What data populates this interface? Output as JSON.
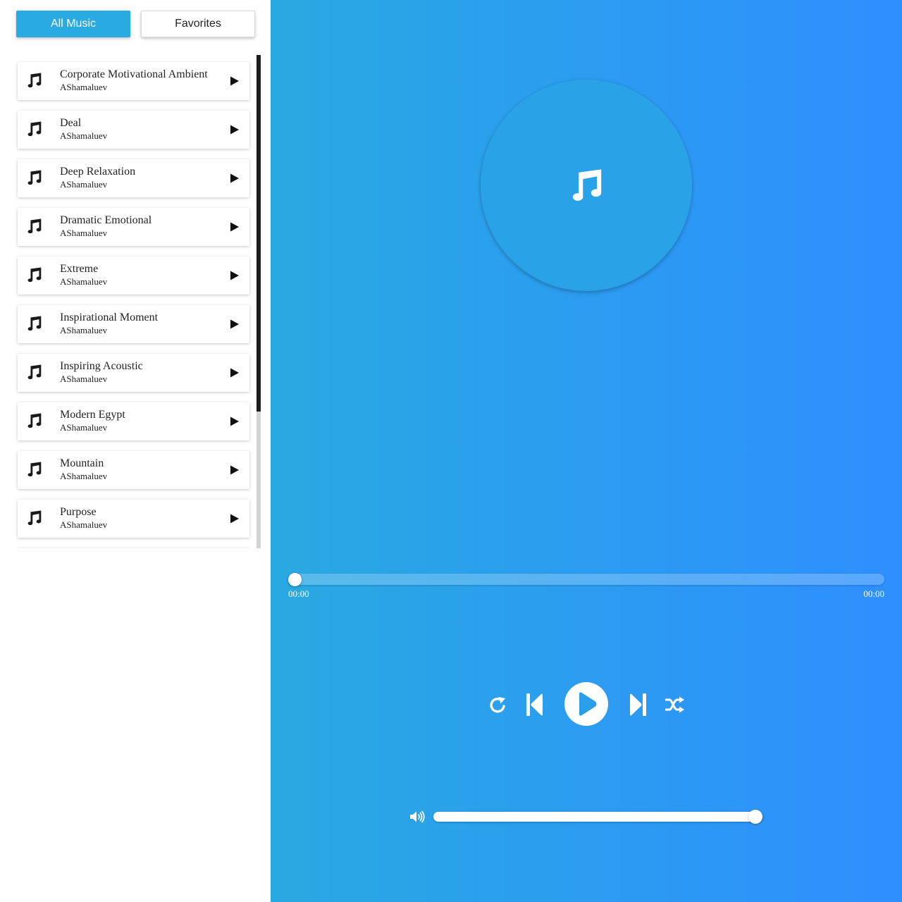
{
  "tabs": {
    "all_music": "All Music",
    "favorites": "Favorites"
  },
  "playlist": [
    {
      "title": "Corporate Motivational Ambient",
      "artist": "AShamaluev"
    },
    {
      "title": "Deal",
      "artist": "AShamaluev"
    },
    {
      "title": "Deep Relaxation",
      "artist": "AShamaluev"
    },
    {
      "title": "Dramatic Emotional",
      "artist": "AShamaluev"
    },
    {
      "title": "Extreme",
      "artist": "AShamaluev"
    },
    {
      "title": "Inspirational Moment",
      "artist": "AShamaluev"
    },
    {
      "title": "Inspiring Acoustic",
      "artist": "AShamaluev"
    },
    {
      "title": "Modern Egypt",
      "artist": "AShamaluev"
    },
    {
      "title": "Mountain",
      "artist": "AShamaluev"
    },
    {
      "title": "Purpose",
      "artist": "AShamaluev"
    }
  ],
  "player": {
    "current_time": "00:00",
    "total_time": "00:00",
    "progress": 0,
    "volume": 1.0
  },
  "icons": {
    "track": "music-note-icon",
    "track_play": "play-icon",
    "cover": "music-note-icon",
    "repeat": "repeat-icon",
    "previous": "skip-previous-icon",
    "play": "play-icon",
    "next": "skip-next-icon",
    "shuffle": "shuffle-icon",
    "volume": "volume-icon"
  },
  "colors": {
    "accent": "#29abe2",
    "gradient_start": "#29a9e1",
    "gradient_end": "#2e8fff"
  }
}
